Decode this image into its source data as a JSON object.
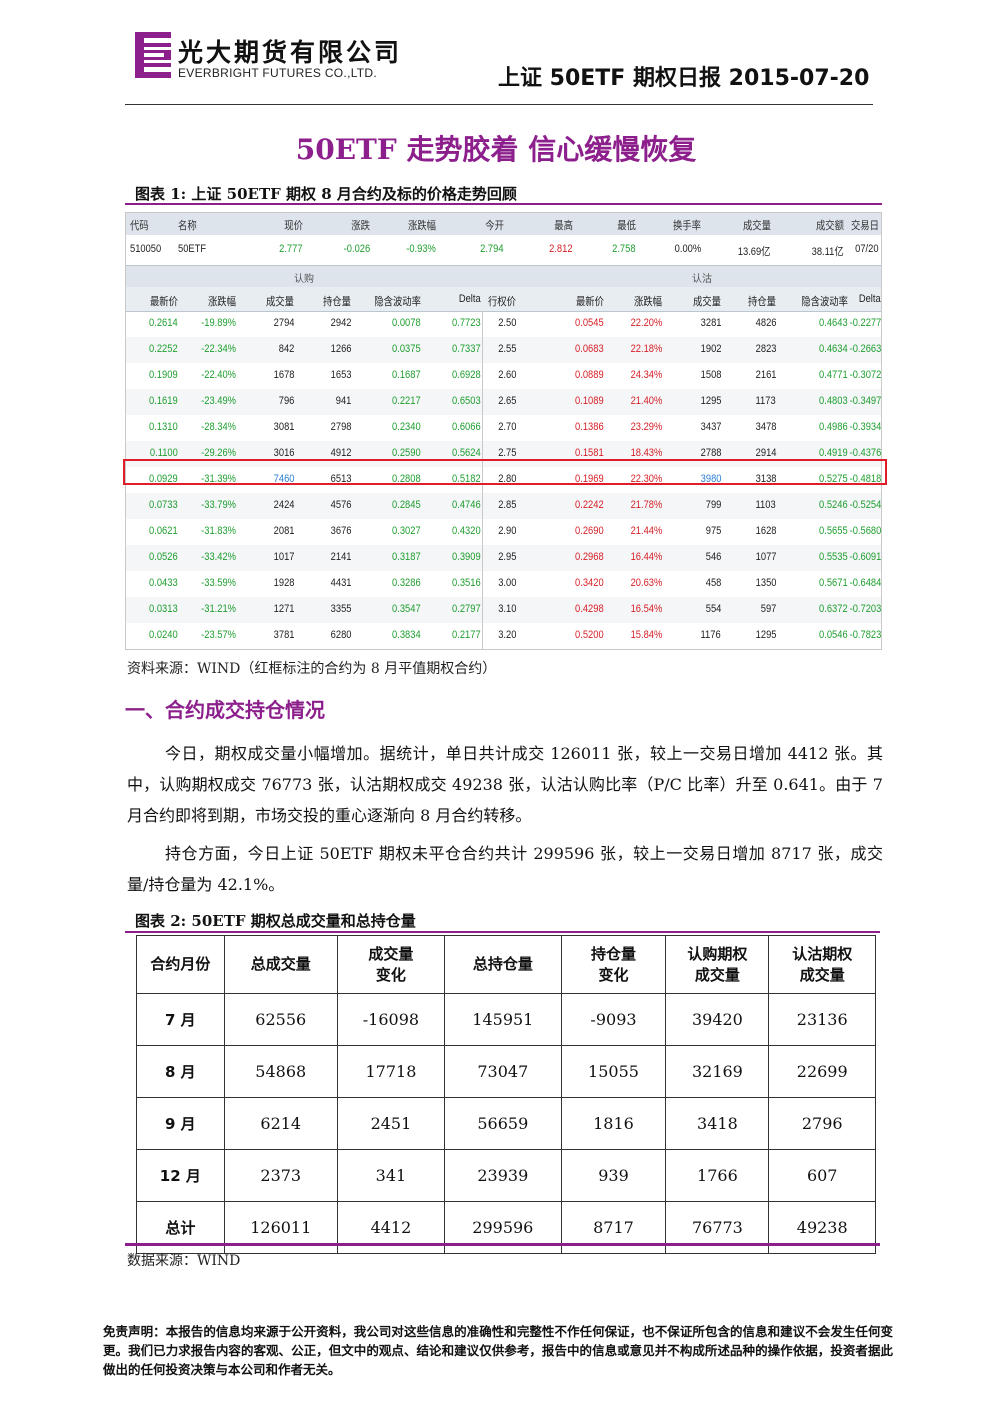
{
  "header": {
    "company_cn": "光大期货有限公司",
    "company_en": "EVERBRIGHT FUTURES CO.,LTD.",
    "report_title": "上证 50ETF 期权日报 2015-07-20",
    "logo_color": "#8c1f8c"
  },
  "main_title": "50ETF 走势胶着  信心缓慢恢复",
  "figure1": {
    "caption": "图表 1:  上证 50ETF 期权 8 月合约及标的价格走势回顾",
    "underlying_headers": [
      "代码",
      "名称",
      "现价",
      "涨跌",
      "涨跌幅",
      "今开",
      "最高",
      "最低",
      "换手率",
      "成交量",
      "成交额",
      "交易日"
    ],
    "underlying_values": [
      "510050",
      "50ETF",
      "2.777",
      "-0.026",
      "-0.93%",
      "2.794",
      "2.812",
      "2.758",
      "0.00%",
      "13.69亿",
      "38.11亿",
      "07/20"
    ],
    "group_call": "认购",
    "group_put": "认沽",
    "column_headers": [
      "最新价",
      "涨跌幅",
      "成交量",
      "持仓量",
      "隐含波动率",
      "Delta",
      "行权价",
      "最新价",
      "涨跌幅",
      "成交量",
      "持仓量",
      "隐含波动率",
      "Delta"
    ],
    "rows": [
      [
        "0.2614",
        "-19.89%",
        "2794",
        "2942",
        "0.0078",
        "0.7723",
        "2.50",
        "0.0545",
        "22.20%",
        "3281",
        "4826",
        "0.4643",
        "-0.2277"
      ],
      [
        "0.2252",
        "-22.34%",
        "842",
        "1266",
        "0.0375",
        "0.7337",
        "2.55",
        "0.0683",
        "22.18%",
        "1902",
        "2823",
        "0.4634",
        "-0.2663"
      ],
      [
        "0.1909",
        "-22.40%",
        "1678",
        "1653",
        "0.1687",
        "0.6928",
        "2.60",
        "0.0889",
        "24.34%",
        "1508",
        "2161",
        "0.4771",
        "-0.3072"
      ],
      [
        "0.1619",
        "-23.49%",
        "796",
        "941",
        "0.2217",
        "0.6503",
        "2.65",
        "0.1089",
        "21.40%",
        "1295",
        "1173",
        "0.4803",
        "-0.3497"
      ],
      [
        "0.1310",
        "-28.34%",
        "3081",
        "2798",
        "0.2340",
        "0.6066",
        "2.70",
        "0.1386",
        "23.29%",
        "3437",
        "3478",
        "0.4986",
        "-0.3934"
      ],
      [
        "0.1100",
        "-29.26%",
        "3016",
        "4912",
        "0.2590",
        "0.5624",
        "2.75",
        "0.1581",
        "18.43%",
        "2788",
        "2914",
        "0.4919",
        "-0.4376"
      ],
      [
        "0.0929",
        "-31.39%",
        "7460",
        "6513",
        "0.2808",
        "0.5182",
        "2.80",
        "0.1969",
        "22.30%",
        "3980",
        "3138",
        "0.5275",
        "-0.4818"
      ],
      [
        "0.0733",
        "-33.79%",
        "2424",
        "4576",
        "0.2845",
        "0.4746",
        "2.85",
        "0.2242",
        "21.78%",
        "799",
        "1103",
        "0.5246",
        "-0.5254"
      ],
      [
        "0.0621",
        "-31.83%",
        "2081",
        "3676",
        "0.3027",
        "0.4320",
        "2.90",
        "0.2690",
        "21.44%",
        "975",
        "1628",
        "0.5655",
        "-0.5680"
      ],
      [
        "0.0526",
        "-33.42%",
        "1017",
        "2141",
        "0.3187",
        "0.3909",
        "2.95",
        "0.2968",
        "16.44%",
        "546",
        "1077",
        "0.5535",
        "-0.6091"
      ],
      [
        "0.0433",
        "-33.59%",
        "1928",
        "4431",
        "0.3286",
        "0.3516",
        "3.00",
        "0.3420",
        "20.63%",
        "458",
        "1350",
        "0.5671",
        "-0.6484"
      ],
      [
        "0.0313",
        "-31.21%",
        "1271",
        "3355",
        "0.3547",
        "0.2797",
        "3.10",
        "0.4298",
        "16.54%",
        "554",
        "597",
        "0.6372",
        "-0.7203"
      ],
      [
        "0.0240",
        "-23.57%",
        "3781",
        "6280",
        "0.3834",
        "0.2177",
        "3.20",
        "0.5200",
        "15.84%",
        "1176",
        "1295",
        "0.0546",
        "-0.7823"
      ]
    ],
    "highlight_row_index": 6,
    "source": "资料来源：WIND（红框标注的合约为 8 月平值期权合约）"
  },
  "section1": {
    "title": "一、合约成交持仓情况",
    "para1": "今日，期权成交量小幅增加。据统计，单日共计成交 126011 张，较上一交易日增加 4412 张。其中，认购期权成交 76773 张，认沽期权成交 49238 张，认沽认购比率（P/C 比率）升至 0.641。由于 7 月合约即将到期，市场交投的重心逐渐向 8 月合约转移。",
    "para2": "持仓方面，今日上证 50ETF 期权未平仓合约共计 299596 张，较上一交易日增加 8717 张，成交量/持仓量为 42.1%。"
  },
  "figure2": {
    "caption": "图表 2:  50ETF 期权总成交量和总持仓量",
    "headers": [
      "合约月份",
      "总成交量",
      "成交量\n变化",
      "总持仓量",
      "持仓量\n变化",
      "认购期权\n成交量",
      "认沽期权\n成交量"
    ],
    "rows": [
      [
        "7 月",
        "62556",
        "-16098",
        "145951",
        "-9093",
        "39420",
        "23136"
      ],
      [
        "8 月",
        "54868",
        "17718",
        "73047",
        "15055",
        "32169",
        "22699"
      ],
      [
        "9 月",
        "6214",
        "2451",
        "56659",
        "1816",
        "3418",
        "2796"
      ],
      [
        "12 月",
        "2373",
        "341",
        "23939",
        "939",
        "1766",
        "607"
      ],
      [
        "总计",
        "126011",
        "4412",
        "299596",
        "8717",
        "76773",
        "49238"
      ]
    ],
    "source": "数据来源：WIND"
  },
  "disclaimer": "免责声明：本报告的信息均来源于公开资料，我公司对这些信息的准确性和完整性不作任何保证，也不保证所包含的信息和建议不会发生任何变更。我们已力求报告内容的客观、公正，但文中的观点、结论和建议仅供参考，报告中的信息或意见并不构成所述品种的操作依据，投资者据此做出的任何投资决策与本公司和作者无关。"
}
